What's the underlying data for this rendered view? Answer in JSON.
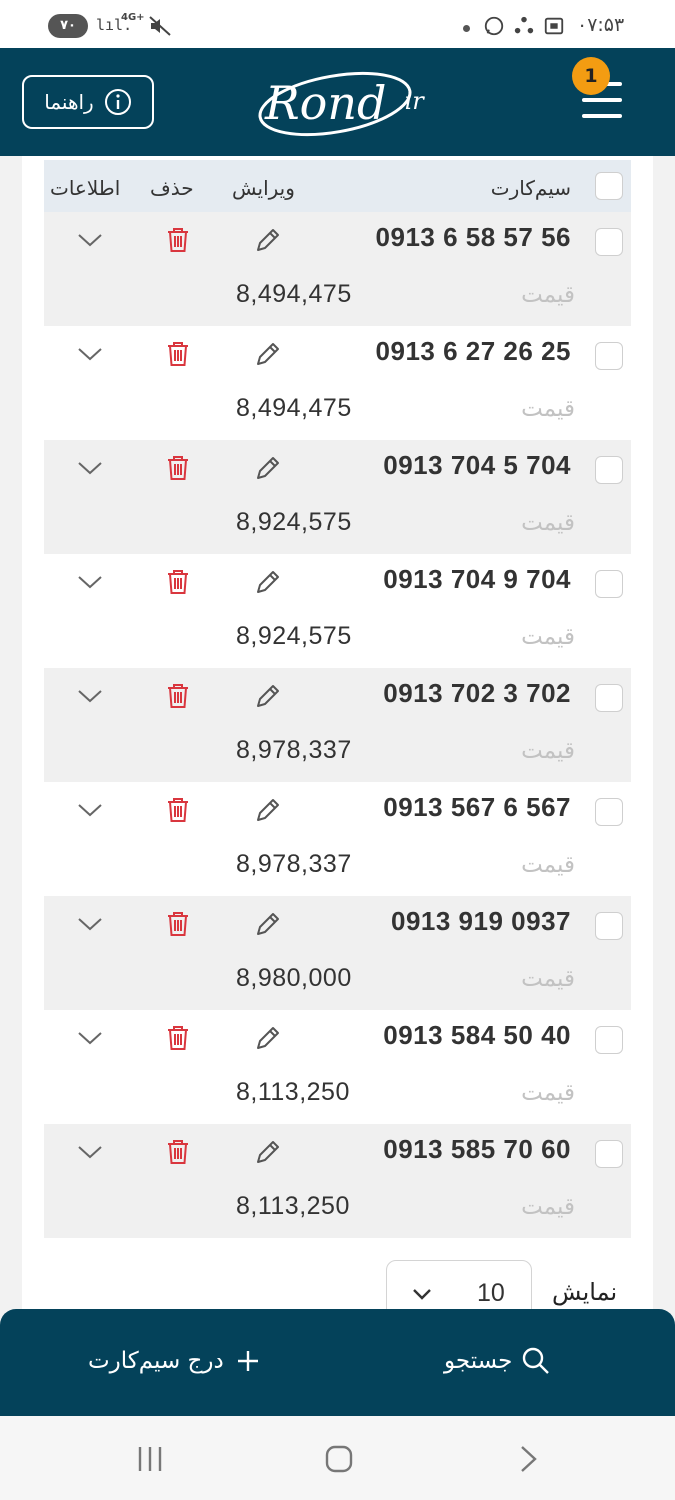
{
  "status_bar": {
    "battery": "۷۰",
    "signal": "lıl.",
    "network": "4G+",
    "time": "۰۷:۵۳"
  },
  "header": {
    "help_label": "راهنما",
    "logo_text": "Rond",
    "logo_suffix": ".ir",
    "notification_count": "1"
  },
  "table": {
    "columns": {
      "sim": "سیم‌کارت",
      "edit": "ویرایش",
      "delete": "حذف",
      "info": "اطلاعات"
    },
    "price_label": "قیمت",
    "rows": [
      {
        "number": "0913 6 58 57 56",
        "price": "8,494,475"
      },
      {
        "number": "0913 6 27 26 25",
        "price": "8,494,475"
      },
      {
        "number": "0913 704 5 704",
        "price": "8,924,575"
      },
      {
        "number": "0913 704 9 704",
        "price": "8,924,575"
      },
      {
        "number": "0913 702 3 702",
        "price": "8,978,337"
      },
      {
        "number": "0913 567 6 567",
        "price": "8,978,337"
      },
      {
        "number": "0913 919 0937",
        "price": "8,980,000"
      },
      {
        "number": "0913 584 50 40",
        "price": "8,113,250"
      },
      {
        "number": "0913 585 70 60",
        "price": "8,113,250"
      }
    ]
  },
  "pagination": {
    "show_label": "نمایش",
    "page_size": "10"
  },
  "bottom_bar": {
    "search_label": "جستجو",
    "add_label": "درج سیم‌کارت"
  },
  "colors": {
    "header_bg": "#04425a",
    "badge": "#f39c12",
    "delete_icon": "#d9363e",
    "table_header_bg": "#e5ebf1",
    "row_shade": "#f0f0f0"
  }
}
